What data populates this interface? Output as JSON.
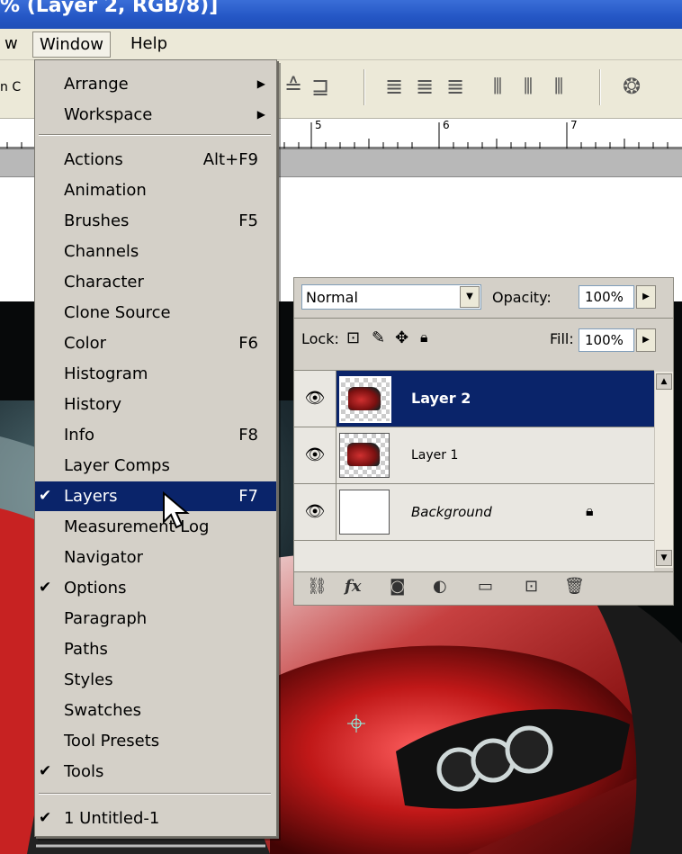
{
  "window_title": "% (Layer 2, RGB/8)]",
  "menubar": {
    "items": [
      {
        "label": "w"
      },
      {
        "label": "Window"
      },
      {
        "label": "Help"
      }
    ]
  },
  "options_bar": {
    "partial_text": "n C"
  },
  "ruler": {
    "ticks": [
      "5",
      "6",
      "7"
    ]
  },
  "window_menu": {
    "top": [
      {
        "label": "Arrange",
        "submenu": true
      },
      {
        "label": "Workspace",
        "submenu": true
      }
    ],
    "panels": [
      {
        "label": "Actions",
        "shortcut": "Alt+F9"
      },
      {
        "label": "Animation",
        "shortcut": ""
      },
      {
        "label": "Brushes",
        "shortcut": "F5"
      },
      {
        "label": "Channels",
        "shortcut": ""
      },
      {
        "label": "Character",
        "shortcut": ""
      },
      {
        "label": "Clone Source",
        "shortcut": ""
      },
      {
        "label": "Color",
        "shortcut": "F6"
      },
      {
        "label": "Histogram",
        "shortcut": ""
      },
      {
        "label": "History",
        "shortcut": ""
      },
      {
        "label": "Info",
        "shortcut": "F8"
      },
      {
        "label": "Layer Comps",
        "shortcut": ""
      },
      {
        "label": "Layers",
        "shortcut": "F7",
        "checked": true,
        "highlighted": true
      },
      {
        "label": "Measurement Log",
        "shortcut": ""
      },
      {
        "label": "Navigator",
        "shortcut": ""
      },
      {
        "label": "Options",
        "shortcut": "",
        "checked": true
      },
      {
        "label": "Paragraph",
        "shortcut": ""
      },
      {
        "label": "Paths",
        "shortcut": ""
      },
      {
        "label": "Styles",
        "shortcut": ""
      },
      {
        "label": "Swatches",
        "shortcut": ""
      },
      {
        "label": "Tool Presets",
        "shortcut": ""
      },
      {
        "label": "Tools",
        "shortcut": "",
        "checked": true
      }
    ],
    "documents": [
      {
        "label": "1 Untitled-1",
        "checked": true
      }
    ]
  },
  "layers_panel": {
    "blend_mode": "Normal",
    "opacity_label": "Opacity:",
    "opacity_value": "100%",
    "lock_label": "Lock:",
    "fill_label": "Fill:",
    "fill_value": "100%",
    "layers": [
      {
        "name": "Layer 2",
        "active": true,
        "visible": true
      },
      {
        "name": "Layer 1",
        "active": false,
        "visible": true
      },
      {
        "name": "Background",
        "active": false,
        "visible": true,
        "locked": true
      }
    ]
  },
  "colors": {
    "title_bar": "#2456c4",
    "menu_highlight": "#0a246a",
    "menu_bg": "#d4d0c8",
    "car_red": "#c82020"
  }
}
